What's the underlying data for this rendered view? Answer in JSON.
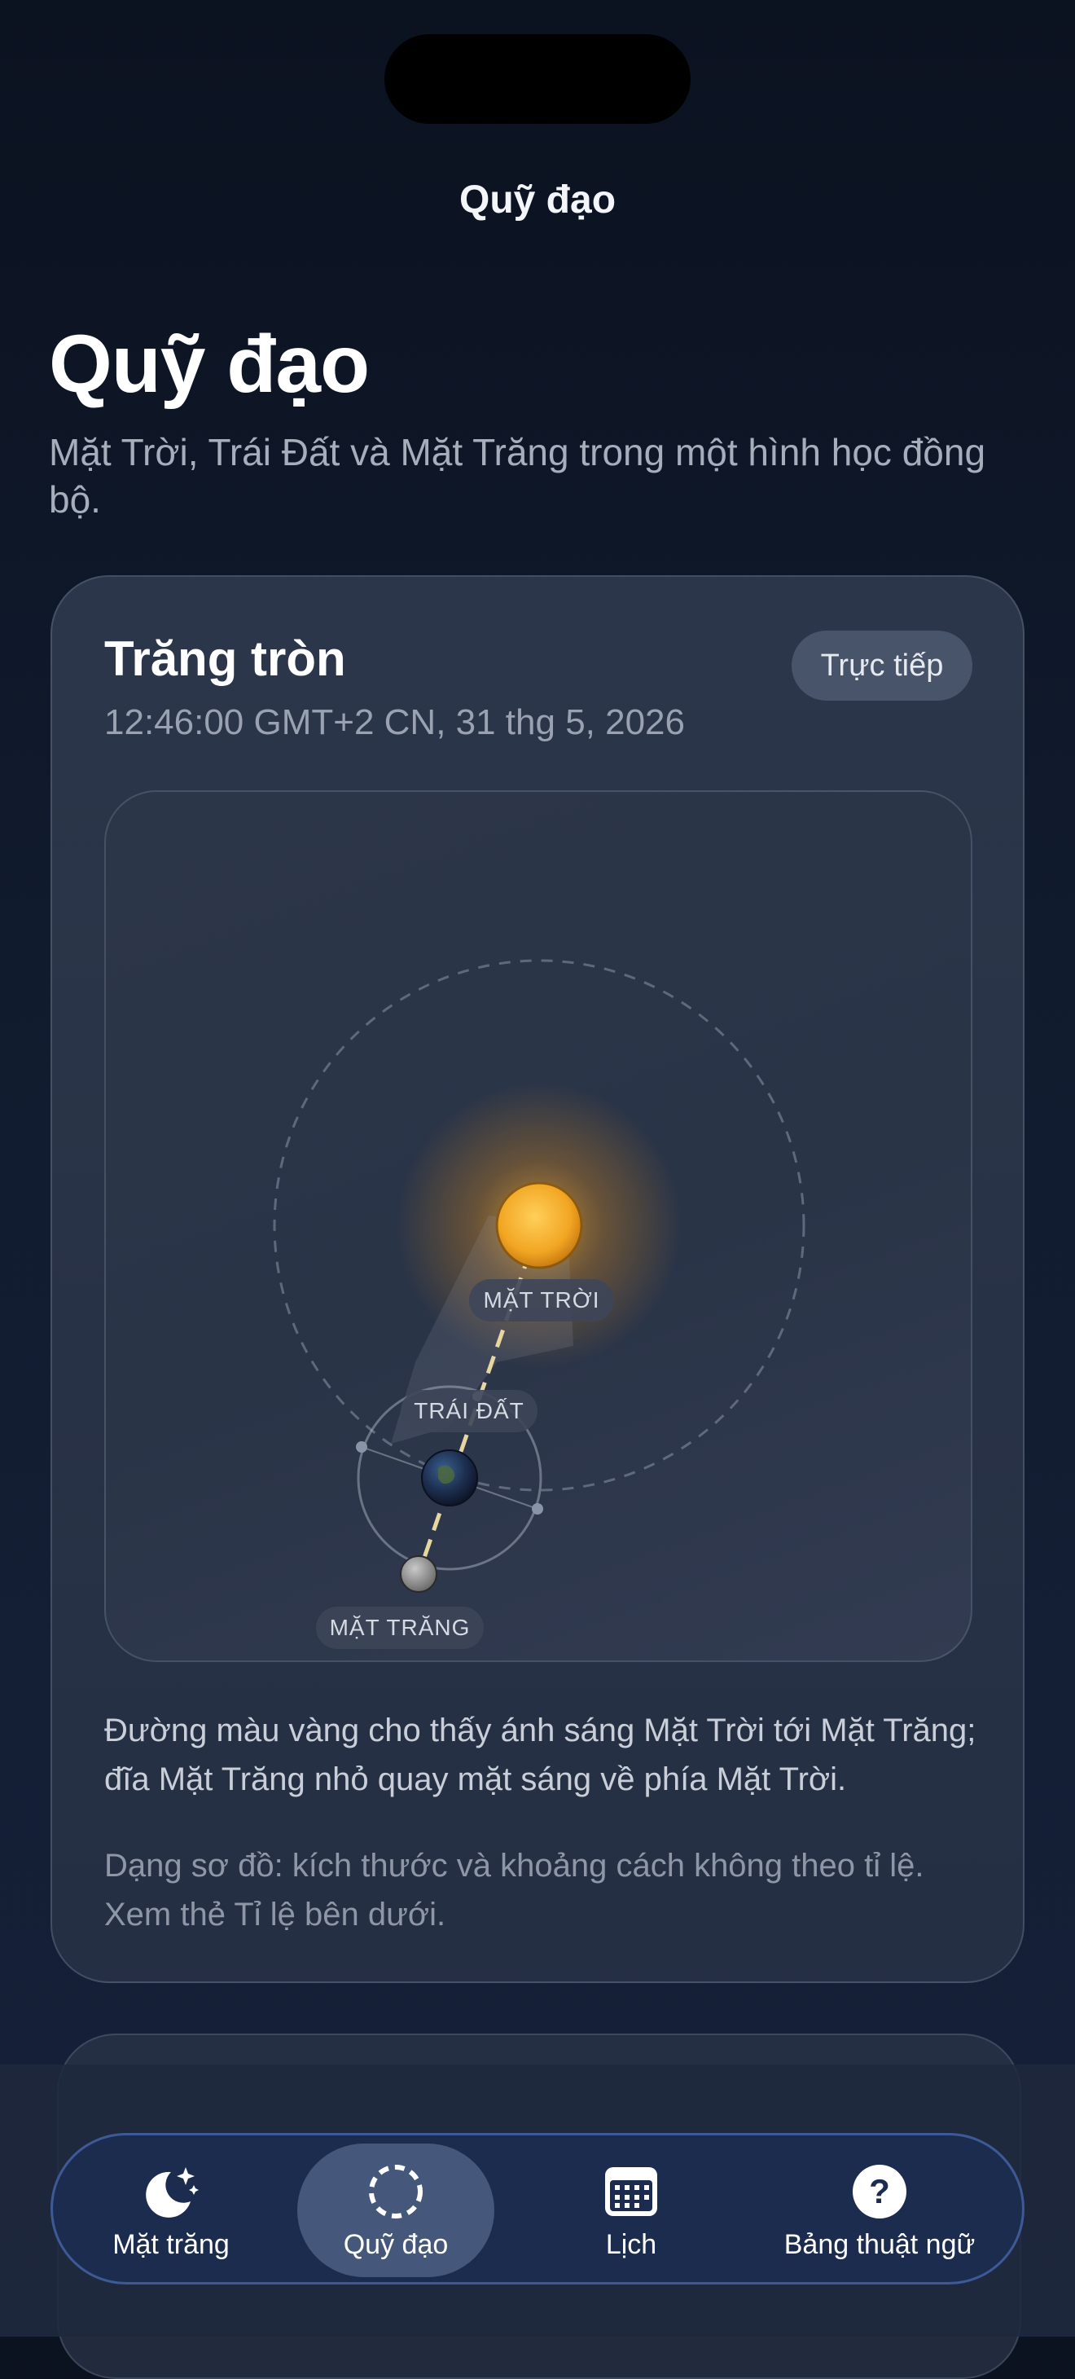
{
  "nav": {
    "title": "Quỹ đạo"
  },
  "header": {
    "title": "Quỹ đạo",
    "subtitle": "Mặt Trời, Trái Đất và Mặt Trăng trong một hình học đồng bộ."
  },
  "card": {
    "phase": "Trăng tròn",
    "datetime": "12:46:00 GMT+2 CN, 31 thg 5, 2026",
    "live_button": "Trực tiếp",
    "labels": {
      "sun": "MẶT TRỜI",
      "earth": "TRÁI ĐẤT",
      "moon": "MẶT TRĂNG"
    },
    "description": "Đường màu vàng cho thấy ánh sáng Mặt Trời tới Mặt Trăng; đĩa Mặt Trăng nhỏ quay mặt sáng về phía Mặt Trời.",
    "note": "Dạng sơ đồ: kích thước và khoảng cách không theo tỉ lệ. Xem thẻ Tỉ lệ bên dưới."
  },
  "colors": {
    "sun": "#f2a623",
    "light_path": "#e8d6a0",
    "accent_border": "#5a82d2"
  },
  "tabs": [
    {
      "label": "Mặt trăng",
      "icon": "moon-stars-icon",
      "active": false
    },
    {
      "label": "Quỹ đạo",
      "icon": "orbit-dashed-circle-icon",
      "active": true
    },
    {
      "label": "Lịch",
      "icon": "calendar-icon",
      "active": false
    },
    {
      "label": "Bảng thuật ngữ",
      "icon": "question-circle-icon",
      "active": false
    }
  ]
}
